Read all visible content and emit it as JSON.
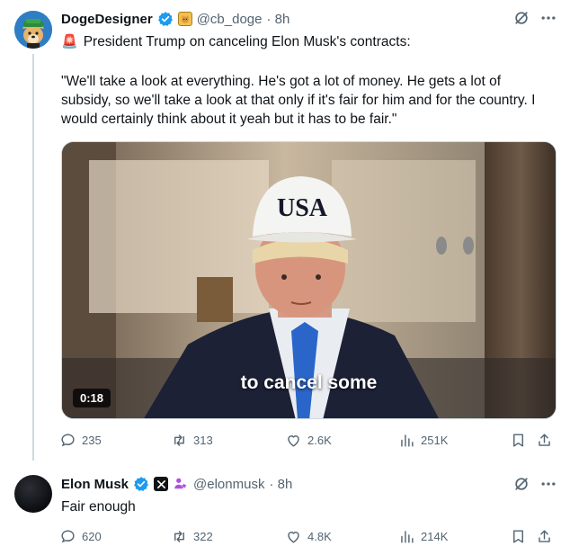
{
  "tweet1": {
    "display_name": "DogeDesigner",
    "handle": "@cb_doge",
    "time": "· 8h",
    "alert_emoji": "🚨",
    "headline": "President Trump on canceling Elon Musk's contracts:",
    "quote": "\"We'll take a look at everything. He's got a lot of money. He gets a lot of subsidy, so we'll take a look at that only if it's fair for him and for the country. I would certainly think about it yeah but it has to be fair.\"",
    "video": {
      "caption": "to cancel some",
      "hat_text": "USA",
      "duration": "0:18"
    },
    "stats": {
      "replies": "235",
      "reposts": "313",
      "likes": "2.6K",
      "views": "251K"
    }
  },
  "tweet2": {
    "display_name": "Elon Musk",
    "handle": "@elonmusk",
    "time": "· 8h",
    "text": "Fair enough",
    "stats": {
      "replies": "620",
      "reposts": "322",
      "likes": "4.8K",
      "views": "214K"
    }
  },
  "colors": {
    "verified_blue": "#1d9bf0",
    "secondary_text": "#536471",
    "primary_text": "#0f1419",
    "affiliate_purple": "#b24fe0"
  },
  "icons": [
    "verified-badge-icon",
    "doge-badge-icon",
    "x-badge-icon",
    "affiliate-icon",
    "grok-icon",
    "more-icon",
    "reply-icon",
    "repost-icon",
    "like-icon",
    "views-icon",
    "bookmark-icon",
    "share-icon",
    "alert-siren-icon"
  ]
}
